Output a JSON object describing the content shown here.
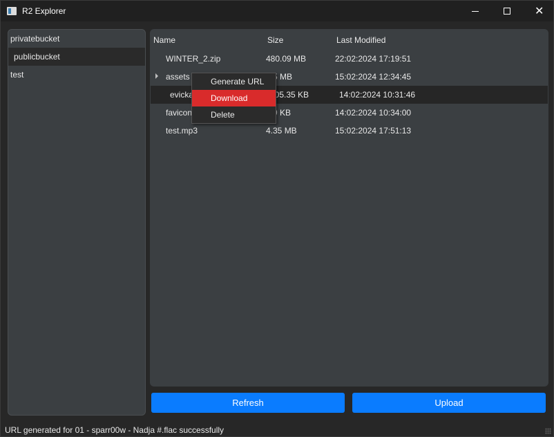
{
  "window": {
    "title": "R2 Explorer",
    "icon": "app-icon"
  },
  "buckets": [
    {
      "label": "privatebucket"
    },
    {
      "label": "publicbucket",
      "selected": true
    },
    {
      "label": "test"
    }
  ],
  "table": {
    "headers": {
      "name": "Name",
      "size": "Size",
      "modified": "Last Modified"
    },
    "rows": [
      {
        "name": "WINTER_2.zip",
        "size": "480.09 MB",
        "modified": "22:02:2024 17:19:51"
      },
      {
        "name": "assets",
        "size": "2.5 MB",
        "modified": "15:02:2024 12:34:45",
        "expandable": true
      },
      {
        "name": "evicka",
        "size": "905.35 KB",
        "modified": "14:02:2024 10:31:46",
        "selected": true
      },
      {
        "name": "favicon",
        "size": "5.9 KB",
        "modified": "14:02:2024 10:34:00"
      },
      {
        "name": "test.mp3",
        "size": "4.35 MB",
        "modified": "15:02:2024 17:51:13"
      }
    ]
  },
  "context_menu": {
    "items": [
      {
        "label": "Generate URL"
      },
      {
        "label": "Download",
        "highlighted": true
      },
      {
        "label": "Delete"
      }
    ]
  },
  "buttons": {
    "refresh": "Refresh",
    "upload": "Upload"
  },
  "status": "URL generated for 01 - sparr00w - Nadja #.flac successfully",
  "colors": {
    "accent": "#0a7cff",
    "highlight": "#d92b2b",
    "panel": "#3b3f42",
    "background": "#272727"
  }
}
